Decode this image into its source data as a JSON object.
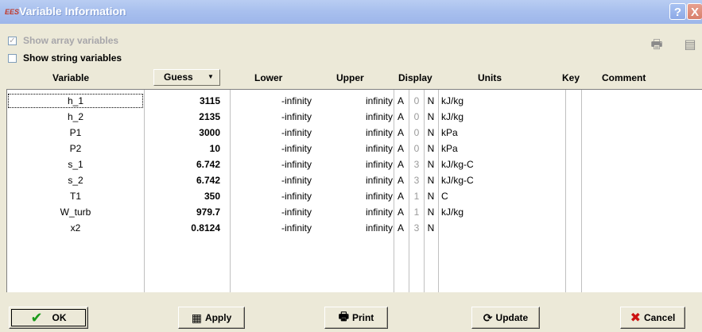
{
  "window": {
    "title": "Variable Information",
    "app_icon_text": "EES",
    "help_label": "?",
    "close_label": "X"
  },
  "options": {
    "show_array_label": "Show array variables",
    "show_string_label": "Show string variables"
  },
  "columns": {
    "variable": "Variable",
    "guess": "Guess",
    "lower": "Lower",
    "upper": "Upper",
    "display": "Display",
    "units": "Units",
    "key": "Key",
    "comment": "Comment"
  },
  "rows": [
    {
      "variable": "h_1",
      "guess": "3115",
      "lower": "-infinity",
      "upper": "infinity",
      "fmt": "A",
      "digits": "0",
      "n": "N",
      "units": "kJ/kg"
    },
    {
      "variable": "h_2",
      "guess": "2135",
      "lower": "-infinity",
      "upper": "infinity",
      "fmt": "A",
      "digits": "0",
      "n": "N",
      "units": "kJ/kg"
    },
    {
      "variable": "P1",
      "guess": "3000",
      "lower": "-infinity",
      "upper": "infinity",
      "fmt": "A",
      "digits": "0",
      "n": "N",
      "units": "kPa"
    },
    {
      "variable": "P2",
      "guess": "10",
      "lower": "-infinity",
      "upper": "infinity",
      "fmt": "A",
      "digits": "0",
      "n": "N",
      "units": "kPa"
    },
    {
      "variable": "s_1",
      "guess": "6.742",
      "lower": "-infinity",
      "upper": "infinity",
      "fmt": "A",
      "digits": "3",
      "n": "N",
      "units": "kJ/kg-C"
    },
    {
      "variable": "s_2",
      "guess": "6.742",
      "lower": "-infinity",
      "upper": "infinity",
      "fmt": "A",
      "digits": "3",
      "n": "N",
      "units": "kJ/kg-C"
    },
    {
      "variable": "T1",
      "guess": "350",
      "lower": "-infinity",
      "upper": "infinity",
      "fmt": "A",
      "digits": "1",
      "n": "N",
      "units": "C"
    },
    {
      "variable": "W_turb",
      "guess": "979.7",
      "lower": "-infinity",
      "upper": "infinity",
      "fmt": "A",
      "digits": "1",
      "n": "N",
      "units": "kJ/kg"
    },
    {
      "variable": "x2",
      "guess": "0.8124",
      "lower": "-infinity",
      "upper": "infinity",
      "fmt": "A",
      "digits": "3",
      "n": "N",
      "units": ""
    }
  ],
  "buttons": {
    "ok": "OK",
    "apply": "Apply",
    "print": "Print",
    "update": "Update",
    "cancel": "Cancel"
  },
  "colors": {
    "ok_check": "#1a9a1a",
    "cancel_x": "#cc1111"
  }
}
